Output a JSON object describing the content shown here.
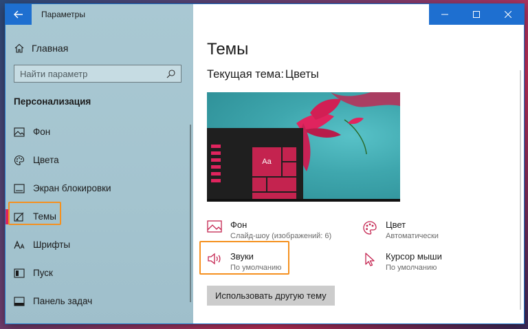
{
  "window": {
    "app_title": "Параметры",
    "back_icon": "back-arrow-icon"
  },
  "sidebar": {
    "home": {
      "label": "Главная",
      "icon": "home-icon"
    },
    "search": {
      "placeholder": "Найти параметр",
      "icon": "search-icon"
    },
    "section_title": "Персонализация",
    "items": [
      {
        "label": "Фон",
        "icon": "image-icon",
        "active": false
      },
      {
        "label": "Цвета",
        "icon": "palette-icon",
        "active": false
      },
      {
        "label": "Экран блокировки",
        "icon": "lock-screen-icon",
        "active": false
      },
      {
        "label": "Темы",
        "icon": "brush-icon",
        "active": true
      },
      {
        "label": "Шрифты",
        "icon": "font-icon",
        "active": false
      },
      {
        "label": "Пуск",
        "icon": "start-icon",
        "active": false
      },
      {
        "label": "Панель задач",
        "icon": "taskbar-icon",
        "active": false
      }
    ]
  },
  "main": {
    "title": "Темы",
    "current_theme_label": "Текущая тема:",
    "current_theme_name": "Цветы",
    "preview_tile": "Aa",
    "options": {
      "background": {
        "title": "Фон",
        "subtitle": "Слайд-шоу (изображений: 6)",
        "icon": "image-icon"
      },
      "color": {
        "title": "Цвет",
        "subtitle": "Автоматически",
        "icon": "palette-icon"
      },
      "sounds": {
        "title": "Звуки",
        "subtitle": "По умолчанию",
        "icon": "speaker-icon"
      },
      "cursor": {
        "title": "Курсор мыши",
        "subtitle": "По умолчанию",
        "icon": "cursor-icon"
      }
    },
    "use_theme_button": "Использовать другую тему"
  },
  "colors": {
    "accent": "#e0245e",
    "titlebar": "#1e6fd0",
    "highlight": "#f5901e"
  }
}
